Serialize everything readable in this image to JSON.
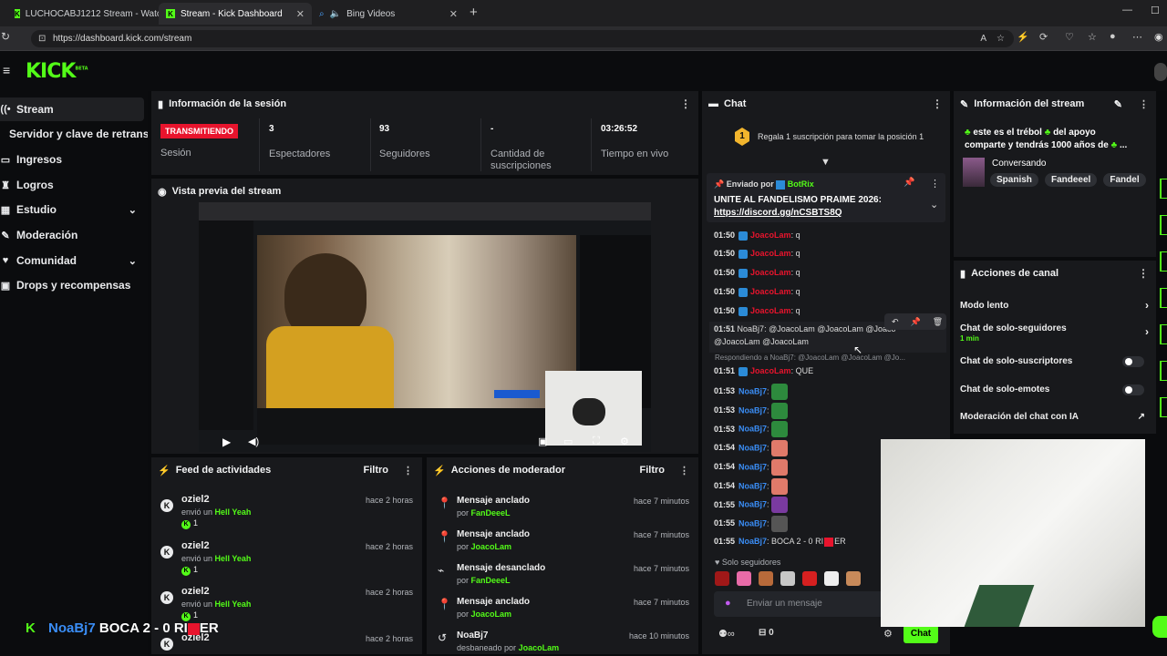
{
  "browser": {
    "tabs": [
      {
        "title": "LUCHOCABJ1212 Stream - Watch"
      },
      {
        "title": "Stream - Kick Dashboard"
      },
      {
        "title": "Bing Videos"
      }
    ],
    "url": "https://dashboard.kick.com/stream"
  },
  "header": {
    "logo": "KICK",
    "logo_sup": "BETA"
  },
  "sidebar": {
    "items": [
      {
        "label": "Stream",
        "icon": "broadcast-icon"
      },
      {
        "label": "Servidor y clave de retransmisión"
      },
      {
        "label": "Ingresos",
        "icon": "money-icon"
      },
      {
        "label": "Logros",
        "icon": "trophy-icon"
      },
      {
        "label": "Estudio",
        "icon": "studio-icon"
      },
      {
        "label": "Moderación",
        "icon": "wrench-icon"
      },
      {
        "label": "Comunidad",
        "icon": "community-icon"
      },
      {
        "label": "Drops y recompensas",
        "icon": "gift-icon"
      }
    ]
  },
  "session": {
    "title": "Información de la sesión",
    "status_badge": "TRANSMITIENDO",
    "status_label": "Sesión",
    "viewers": "3",
    "viewers_label": "Espectadores",
    "followers": "93",
    "followers_label": "Seguidores",
    "subs": "-",
    "subs_label": "Cantidad de suscripciones",
    "uptime": "03:26:52",
    "uptime_label": "Tiempo en vivo"
  },
  "preview": {
    "title": "Vista previa del stream"
  },
  "feed": {
    "title": "Feed de actividades",
    "filter": "Filtro",
    "items": [
      {
        "user": "oziel2",
        "action": "envió un",
        "item": "Hell Yeah",
        "count": "1",
        "time": "hace 2 horas"
      },
      {
        "user": "oziel2",
        "action": "envió un",
        "item": "Hell Yeah",
        "count": "1",
        "time": "hace 2 horas"
      },
      {
        "user": "oziel2",
        "action": "envió un",
        "item": "Hell Yeah",
        "count": "1",
        "time": "hace 2 horas"
      },
      {
        "user": "oziel2",
        "time": "hace 2 horas"
      }
    ]
  },
  "modactions": {
    "title": "Acciones de moderador",
    "filter": "Filtro",
    "items": [
      {
        "action": "Mensaje anclado",
        "by": "por",
        "user": "FanDeeeL",
        "time": "hace 7 minutos"
      },
      {
        "action": "Mensaje anclado",
        "by": "por",
        "user": "JoacoLam",
        "time": "hace 7 minutos"
      },
      {
        "action": "Mensaje desanclado",
        "by": "por",
        "user": "FanDeeeL",
        "time": "hace 7 minutos"
      },
      {
        "action": "Mensaje anclado",
        "by": "por",
        "user": "JoacoLam",
        "time": "hace 7 minutos"
      },
      {
        "action": "NoaBj7",
        "by": "desbaneado por",
        "user": "JoacoLam",
        "time": "hace 10 minutos"
      }
    ]
  },
  "chat": {
    "title": "Chat",
    "sub_position": "1",
    "sub_prompt": "Regala 1 suscripción para tomar la posición 1",
    "pinned_by": "Enviado por",
    "pinned_user": "BotRix",
    "pinned_text": "UNITE AL FANDELISMO PRAIME 2026:",
    "pinned_link": "https://discord.gg/nCSBTS8Q",
    "messages": [
      {
        "time": "01:50",
        "user": "JoacoLam",
        "text": ": q"
      },
      {
        "time": "01:50",
        "user": "JoacoLam",
        "text": ": q"
      },
      {
        "time": "01:50",
        "user": "JoacoLam",
        "text": ": q"
      },
      {
        "time": "01:50",
        "user": "JoacoLam",
        "text": ": q"
      },
      {
        "time": "01:50",
        "user": "JoacoLam",
        "text": ": q"
      }
    ],
    "msg_noa_time": "01:51",
    "msg_noa_user": "NoaBj7",
    "msg_noa_text": ": @JoacoLam @JoacoLam @JoacoLam",
    "msg_noa_text2": "@JoacoLam @JoacoLam",
    "reply_text": "Respondiendo a NoaBj7: @JoacoLam @JoacoLam @Jo...",
    "reply_time": "01:51",
    "reply_user": "JoacoLam",
    "reply_msg": ": QUE",
    "emote_msgs": [
      {
        "time": "01:53",
        "user": "NoaBj7"
      },
      {
        "time": "01:53",
        "user": "NoaBj7"
      },
      {
        "time": "01:53",
        "user": "NoaBj7"
      },
      {
        "time": "01:54",
        "user": "NoaBj7"
      },
      {
        "time": "01:54",
        "user": "NoaBj7"
      },
      {
        "time": "01:54",
        "user": "NoaBj7"
      },
      {
        "time": "01:55",
        "user": "NoaBj7"
      },
      {
        "time": "01:55",
        "user": "NoaBj7"
      }
    ],
    "last_time": "01:55",
    "last_user": "NoaBj7",
    "last_text": ": BOCA 2 - 0 RI",
    "last_text2": "ER",
    "followers_only": "Solo seguidores",
    "input_placeholder": "Enviar un mensaje",
    "stat_count": "0",
    "send_button": "Chat"
  },
  "stream_info": {
    "title": "Información del stream",
    "stream_title_line1": "este es el trébol",
    "stream_title_line1b": "del apoyo",
    "stream_title_line2": "comparte y tendrás 1000 años de",
    "category": "Conversando",
    "tags": [
      "Spanish",
      "Fandeeel",
      "Fandel"
    ]
  },
  "channel_actions": {
    "title": "Acciones de canal",
    "slow_mode": "Modo lento",
    "followers_only": "Chat de solo-seguidores",
    "followers_only_value": "1 min",
    "subs_only": "Chat de solo-suscriptores",
    "emotes_only": "Chat de solo-emotes",
    "ai_moderation": "Moderación del chat con IA"
  },
  "overlay": {
    "user": "NoaBj7",
    "text": "BOCA 2 - 0 RI",
    "text2": "ER"
  },
  "colors": {
    "brand": "#53fc18",
    "live": "#e8142d",
    "panel": "#18191c",
    "mention_blue": "#3a8df5"
  }
}
